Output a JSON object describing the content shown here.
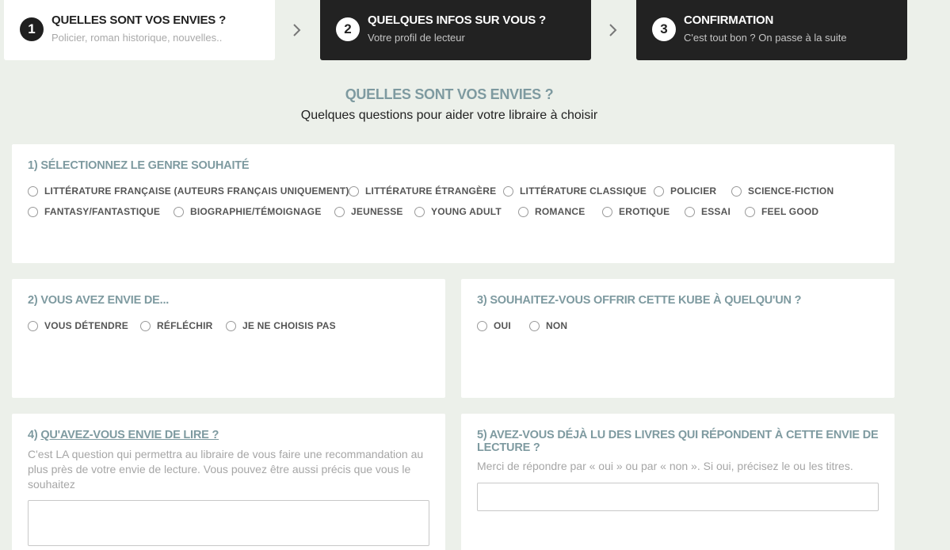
{
  "steps": [
    {
      "number": "1",
      "title": "QUELLES SONT VOS ENVIES ?",
      "subtitle": "Policier, roman historique, nouvelles.."
    },
    {
      "number": "2",
      "title": "QUELQUES INFOS SUR VOUS ?",
      "subtitle": "Votre profil de lecteur"
    },
    {
      "number": "3",
      "title": "CONFIRMATION",
      "subtitle": "C'est tout bon ? On passe à la suite"
    }
  ],
  "main": {
    "title": "QUELLES SONT VOS ENVIES ?",
    "subtitle": "Quelques questions pour aider votre libraire à choisir"
  },
  "q1": {
    "title": "1) SÉLECTIONNEZ LE GENRE SOUHAITÉ",
    "options": [
      "LITTÉRATURE FRANÇAISE (AUTEURS FRANÇAIS UNIQUEMENT)",
      "LITTÉRATURE ÉTRANGÈRE",
      "LITTÉRATURE CLASSIQUE",
      "POLICIER",
      "SCIENCE-FICTION",
      "FANTASY/FANTASTIQUE",
      "BIOGRAPHIE/TÉMOIGNAGE",
      "JEUNESSE",
      "YOUNG ADULT",
      "ROMANCE",
      "EROTIQUE",
      "ESSAI",
      "FEEL GOOD"
    ]
  },
  "q2": {
    "title": "2) VOUS AVEZ ENVIE DE...",
    "options": [
      "VOUS DÉTENDRE",
      "RÉFLÉCHIR",
      "JE NE CHOISIS PAS"
    ]
  },
  "q3": {
    "title": "3) SOUHAITEZ-VOUS OFFRIR CETTE KUBE À QUELQU'UN ?",
    "options": [
      "OUI",
      "NON"
    ]
  },
  "q4": {
    "prefix": "4) ",
    "title": "QU'AVEZ-VOUS ENVIE DE LIRE ?",
    "help": "C'est LA question qui permettra au libraire de vous faire une recommandation au plus près de votre envie de lecture. Vous pouvez être aussi précis que vous le souhaitez",
    "value": ""
  },
  "q5": {
    "title": "5) AVEZ-VOUS DÉJÀ LU DES LIVRES QUI RÉPONDENT À CETTE ENVIE DE LECTURE ?",
    "help": "Merci de répondre par « oui » ou par « non ». Si oui, précisez le ou les titres.",
    "value": ""
  },
  "colors": {
    "background": "#ecf0ea",
    "accent": "#7e9aa0",
    "dark_step": "#222222"
  }
}
